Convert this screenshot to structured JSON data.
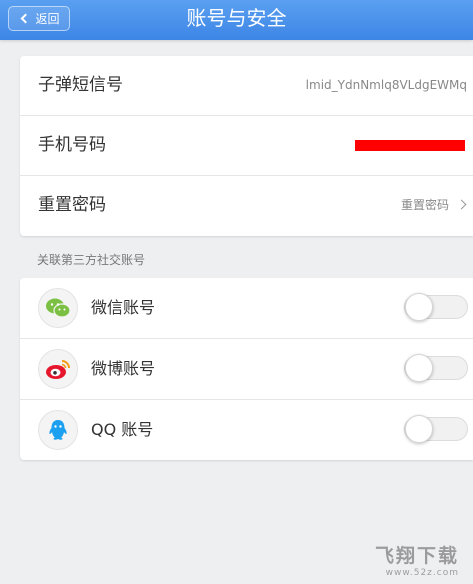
{
  "header": {
    "back_label": "返回",
    "title": "账号与安全"
  },
  "account": {
    "rows": [
      {
        "label": "子弹短信号",
        "value": "lmid_YdnNmlq8VLdgEWMq"
      },
      {
        "label": "手机号码",
        "value": ""
      },
      {
        "label": "重置密码",
        "value": "重置密码"
      }
    ]
  },
  "social": {
    "section_label": "关联第三方社交账号",
    "items": [
      {
        "label": "微信账号",
        "icon": "wechat-icon",
        "enabled": false,
        "color": "#7bc043"
      },
      {
        "label": "微博账号",
        "icon": "weibo-icon",
        "enabled": false,
        "color": "#e6162d"
      },
      {
        "label": "QQ 账号",
        "icon": "qq-icon",
        "enabled": false,
        "color": "#1ea0f0"
      }
    ]
  },
  "colors": {
    "header": "#4a91ec",
    "background": "#eeeff1",
    "redaction": "#ff0000"
  },
  "watermark": {
    "logo": "飞翔下载",
    "url": "www.52z.com"
  }
}
